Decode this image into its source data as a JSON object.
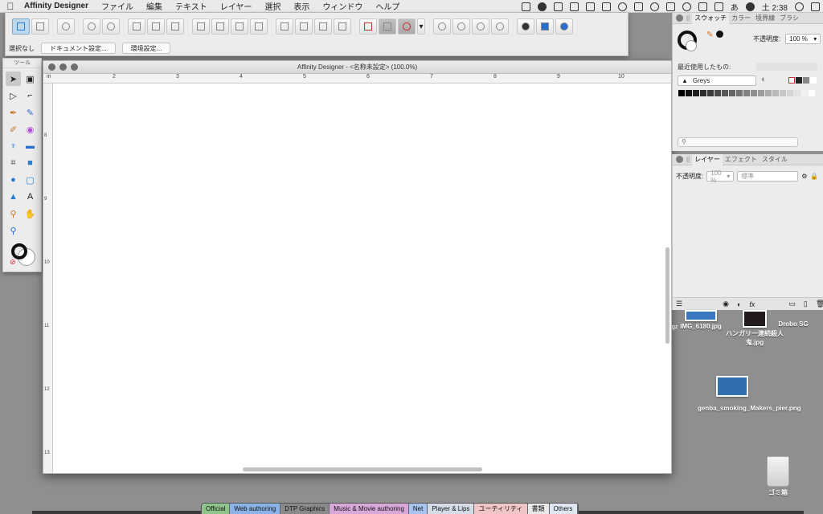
{
  "menubar": {
    "app_name": "Affinity Designer",
    "menus": [
      "ファイル",
      "編集",
      "テキスト",
      "レイヤー",
      "選択",
      "表示",
      "ウィンドウ",
      "ヘルプ"
    ],
    "input_mode": "あ",
    "clock": "土 2:38"
  },
  "toolbar": {
    "no_selection": "選択なし",
    "doc_setup_button": "ドキュメント設定...",
    "prefs_button": "環境設定..."
  },
  "tools_panel": {
    "title": "ツール"
  },
  "document": {
    "window_title": "Affinity Designer - <名称未設定> (100.0%)",
    "ruler_unit": "in",
    "h_ruler_labels": [
      "2",
      "3",
      "4",
      "5",
      "6",
      "7",
      "8",
      "9",
      "10"
    ],
    "v_ruler_labels": [
      "8",
      "9",
      "10",
      "11",
      "12",
      "13"
    ]
  },
  "swatch_panel": {
    "tabs": [
      "スウォッチ",
      "カラー",
      "境界線",
      "ブラシ"
    ],
    "active_tab": "スウォッチ",
    "opacity_label": "不透明度:",
    "opacity_value": "100 %",
    "recent_label": "最近使用したもの:",
    "palette_name": "Greys",
    "greys": [
      "#000000",
      "#111111",
      "#1f1f1f",
      "#2d2d2d",
      "#3b3b3b",
      "#494949",
      "#575757",
      "#656565",
      "#737373",
      "#818181",
      "#8f8f8f",
      "#9d9d9d",
      "#ababab",
      "#b9b9b9",
      "#c7c7c7",
      "#d5d5d5",
      "#e3e3e3",
      "#f1f1f1",
      "#ffffff"
    ]
  },
  "layers_panel": {
    "tabs": [
      "レイヤー",
      "エフェクト",
      "スタイル"
    ],
    "active_tab": "レイヤー",
    "opacity_label": "不透明度:",
    "opacity_value": "100 %",
    "blend_mode": "標準",
    "fx_label": "fx"
  },
  "desktop_icons": {
    "img_name": "IMG_6180.jpg",
    "hungary_name": "ハンガリー連続殺人鬼.jpg",
    "drobo_name": "Drobo SG",
    "gz_label": "gz",
    "genba_name": "genba_smoking_Makers_pier.png",
    "trash_name": "ゴミ箱"
  },
  "dock_tabs": [
    {
      "label": "Official",
      "color": "#8fc58a"
    },
    {
      "label": "Web authoring",
      "color": "#8bb3e8"
    },
    {
      "label": "DTP Graphics",
      "color": "#8a8a8a"
    },
    {
      "label": "Music & Movie authoring",
      "color": "#d8a8d8"
    },
    {
      "label": "Net",
      "color": "#a9c3f0"
    },
    {
      "label": "Player & Lips",
      "color": "#d5dde8"
    },
    {
      "label": "ユーティリティ",
      "color": "#f1c6c6"
    },
    {
      "label": "書類",
      "color": "#e9e9e9"
    },
    {
      "label": "Others",
      "color": "#dfe7f3"
    }
  ]
}
